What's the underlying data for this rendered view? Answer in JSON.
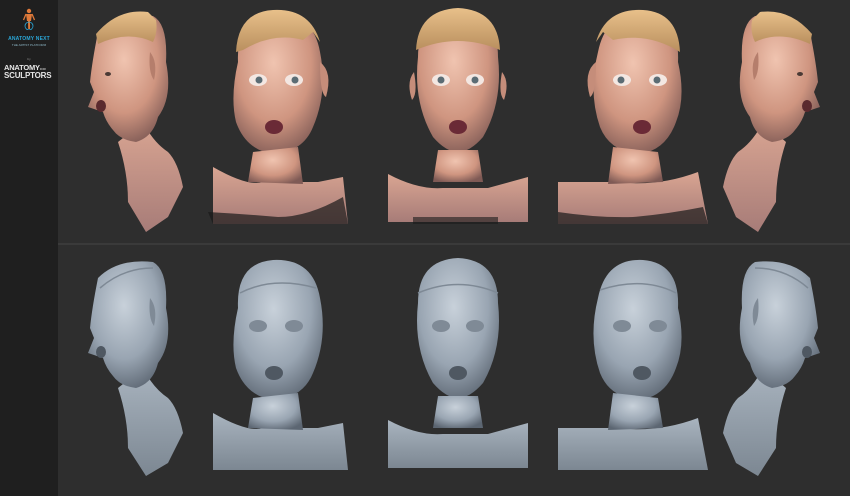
{
  "sidebar": {
    "logo_primary": "ANATOMY NEXT",
    "logo_primary_tagline": "THE ARTIST PLATFORM",
    "by_text": "by",
    "logo_secondary_line1": "ANATOMY",
    "logo_secondary_small": "FOR",
    "logo_secondary_line2": "SCULPTORS"
  },
  "rows": {
    "top": {
      "variant": "textured-scan",
      "views": [
        "left-profile",
        "three-quarter-right",
        "front",
        "three-quarter-left",
        "right-profile"
      ]
    },
    "bottom": {
      "variant": "clay-sculpt",
      "views": [
        "left-profile",
        "three-quarter-right",
        "front",
        "three-quarter-left",
        "right-profile"
      ]
    }
  },
  "colors": {
    "background": "#2e2e2e",
    "sidebar": "#1f1f1f",
    "skin": "#d9a48e",
    "cap": "#d9b27a",
    "clay": "#9ba7b4",
    "brand_blue": "#2aa7d8"
  }
}
